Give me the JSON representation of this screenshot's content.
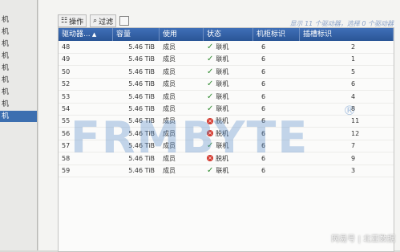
{
  "sidebar": {
    "items": [
      "机",
      "机",
      "机",
      "机",
      "机",
      "机",
      "机",
      "机",
      "机"
    ],
    "selected_index": 8
  },
  "toolbar": {
    "operate_label": "操作",
    "filter_label": "过滤"
  },
  "status_text": "显示 11 个驱动器，选择 0 个驱动器",
  "table": {
    "columns": [
      "驱动器...",
      "容量",
      "使用",
      "状态",
      "机柜标识",
      "插槽标识"
    ],
    "rows": [
      {
        "drive": "48",
        "capacity": "5.46 TiB",
        "usage": "成员",
        "status": "联机",
        "status_ok": true,
        "enclosure": "6",
        "slot": "2"
      },
      {
        "drive": "49",
        "capacity": "5.46 TiB",
        "usage": "成员",
        "status": "联机",
        "status_ok": true,
        "enclosure": "6",
        "slot": "1"
      },
      {
        "drive": "50",
        "capacity": "5.46 TiB",
        "usage": "成员",
        "status": "联机",
        "status_ok": true,
        "enclosure": "6",
        "slot": "5"
      },
      {
        "drive": "52",
        "capacity": "5.46 TiB",
        "usage": "成员",
        "status": "联机",
        "status_ok": true,
        "enclosure": "6",
        "slot": "6"
      },
      {
        "drive": "53",
        "capacity": "5.46 TiB",
        "usage": "成员",
        "status": "联机",
        "status_ok": true,
        "enclosure": "6",
        "slot": "4"
      },
      {
        "drive": "54",
        "capacity": "5.46 TiB",
        "usage": "成员",
        "status": "联机",
        "status_ok": true,
        "enclosure": "6",
        "slot": "8"
      },
      {
        "drive": "55",
        "capacity": "5.46 TiB",
        "usage": "成员",
        "status": "脱机",
        "status_ok": false,
        "enclosure": "6",
        "slot": "11"
      },
      {
        "drive": "56",
        "capacity": "5.46 TiB",
        "usage": "成员",
        "status": "脱机",
        "status_ok": false,
        "enclosure": "6",
        "slot": "12"
      },
      {
        "drive": "57",
        "capacity": "5.46 TiB",
        "usage": "成员",
        "status": "联机",
        "status_ok": true,
        "enclosure": "6",
        "slot": "7"
      },
      {
        "drive": "58",
        "capacity": "5.46 TiB",
        "usage": "成员",
        "status": "脱机",
        "status_ok": false,
        "enclosure": "6",
        "slot": "9"
      },
      {
        "drive": "59",
        "capacity": "5.46 TiB",
        "usage": "成员",
        "status": "联机",
        "status_ok": true,
        "enclosure": "6",
        "slot": "3"
      }
    ]
  },
  "watermark": {
    "text": "FRMBYTE",
    "mark": "®"
  },
  "credit": "网易号 | 北亚数据",
  "colors": {
    "header": "#2a5596",
    "ok": "#2f8a2f",
    "error": "#d43a2f"
  }
}
